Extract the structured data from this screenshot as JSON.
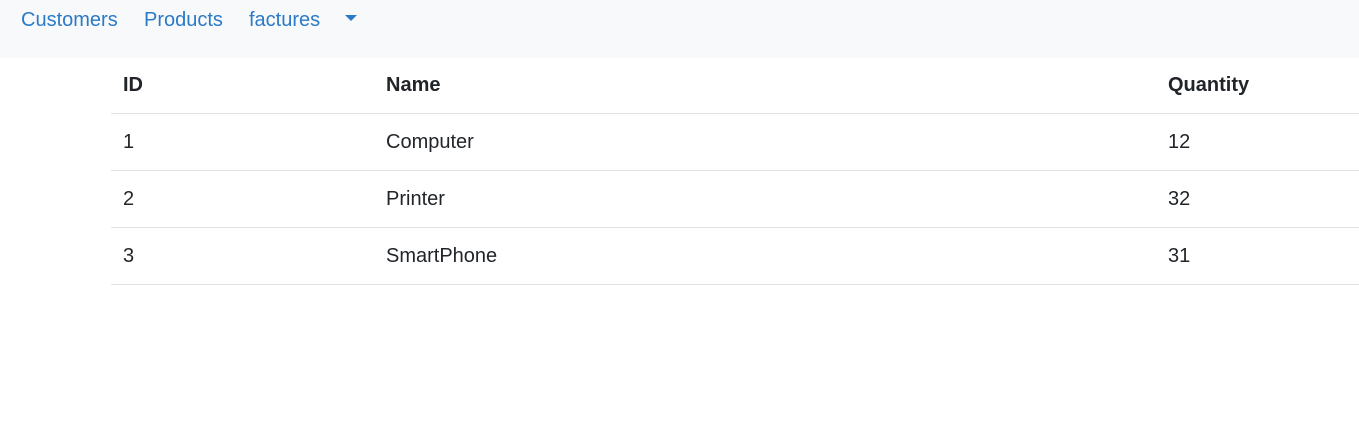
{
  "nav": {
    "links": [
      "Customers",
      "Products",
      "factures"
    ],
    "dropdown_icon": "caret-down-icon",
    "link_color": "#2a7ac8",
    "background": "#f8f9fa"
  },
  "table": {
    "headers": [
      "ID",
      "Name",
      "Quantity"
    ],
    "rows": [
      [
        "1",
        "Computer",
        "12"
      ],
      [
        "2",
        "Printer",
        "32"
      ],
      [
        "3",
        "SmartPhone",
        "31"
      ]
    ]
  }
}
